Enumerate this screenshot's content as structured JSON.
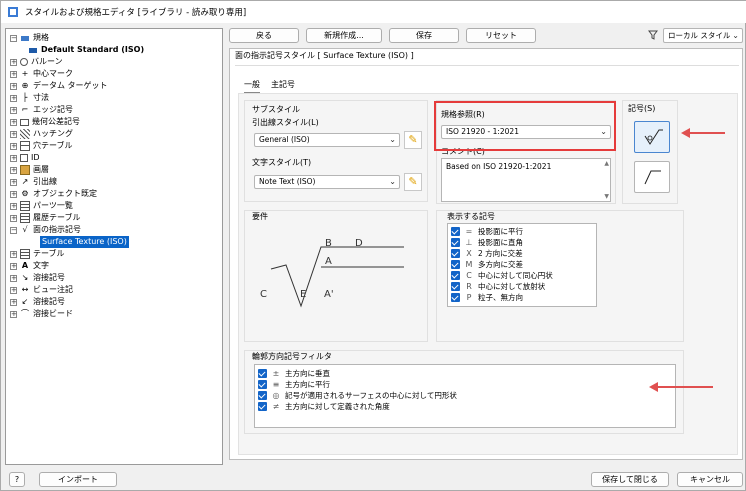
{
  "window": {
    "title": "スタイルおよび規格エディタ [ライブラリ - 読み取り専用]"
  },
  "toolbar": {
    "back": "戻る",
    "new": "新規作成...",
    "save": "保存",
    "reset": "リセット",
    "filter": "ローカル スタイル"
  },
  "tree": {
    "items": [
      {
        "label": "規格",
        "level": 0
      },
      {
        "label": "Default Standard (ISO)",
        "level": 1
      },
      {
        "label": "バルーン",
        "level": 0
      },
      {
        "label": "中心マーク",
        "level": 0
      },
      {
        "label": "データム ターゲット",
        "level": 0
      },
      {
        "label": "寸法",
        "level": 0
      },
      {
        "label": "エッジ記号",
        "level": 0
      },
      {
        "label": "幾何公差記号",
        "level": 0
      },
      {
        "label": "ハッチング",
        "level": 0
      },
      {
        "label": "穴テーブル",
        "level": 0
      },
      {
        "label": "ID",
        "level": 0
      },
      {
        "label": "画層",
        "level": 0
      },
      {
        "label": "引出線",
        "level": 0
      },
      {
        "label": "オブジェクト既定",
        "level": 0
      },
      {
        "label": "パーツ一覧",
        "level": 0
      },
      {
        "label": "履歴テーブル",
        "level": 0
      },
      {
        "label": "面の指示記号",
        "level": 0
      },
      {
        "label": "Surface Texture (ISO)",
        "level": 1
      },
      {
        "label": "テーブル",
        "level": 0
      },
      {
        "label": "文字",
        "level": 0
      },
      {
        "label": "溶接記号",
        "level": 0
      },
      {
        "label": "ビュー注記",
        "level": 0
      },
      {
        "label": "溶接記号",
        "level": 0
      },
      {
        "label": "溶接ビード",
        "level": 0
      }
    ]
  },
  "panel": {
    "header": "面の指示記号スタイル [ Surface Texture (ISO) ]",
    "tabs": [
      "一般",
      "主記号"
    ]
  },
  "substyle": {
    "title": "サブスタイル",
    "leader_label": "引出線スタイル(L)",
    "leader_value": "General (ISO)",
    "text_label": "文字スタイル(T)",
    "text_value": "Note Text (ISO)"
  },
  "standard": {
    "label": "規格参照(R)",
    "value": "ISO 21920 - 1:2021",
    "comment_label": "コメント(C)",
    "comment": "Based on ISO 21920-1:2021"
  },
  "symbol": {
    "label": "記号(S)"
  },
  "requirements": {
    "title": "要件",
    "labels": {
      "b": "B",
      "d": "D",
      "a": "A",
      "c": "C",
      "e": "E",
      "a2": "A'"
    }
  },
  "display": {
    "title": "表示する記号",
    "items": [
      {
        "sym": "=",
        "label": "投影面に平行"
      },
      {
        "sym": "⊥",
        "label": "投影面に直角"
      },
      {
        "sym": "X",
        "label": "2 方向に交差"
      },
      {
        "sym": "M",
        "label": "多方向に交差"
      },
      {
        "sym": "C",
        "label": "中心に対して同心円状"
      },
      {
        "sym": "R",
        "label": "中心に対して放射状"
      },
      {
        "sym": "P",
        "label": "粒子、無方向"
      }
    ]
  },
  "filter": {
    "title": "輪郭方向記号フィルタ",
    "items": [
      {
        "sym": "±",
        "label": "主方向に垂直"
      },
      {
        "sym": "≡",
        "label": "主方向に平行"
      },
      {
        "sym": "◎",
        "label": "記号が適用されるサーフェスの中心に対して円形状"
      },
      {
        "sym": "≠",
        "label": "主方向に対して定義された角度"
      }
    ]
  },
  "footer": {
    "help": "?",
    "import": "インポート",
    "save_close": "保存して閉じる",
    "cancel": "キャンセル"
  }
}
